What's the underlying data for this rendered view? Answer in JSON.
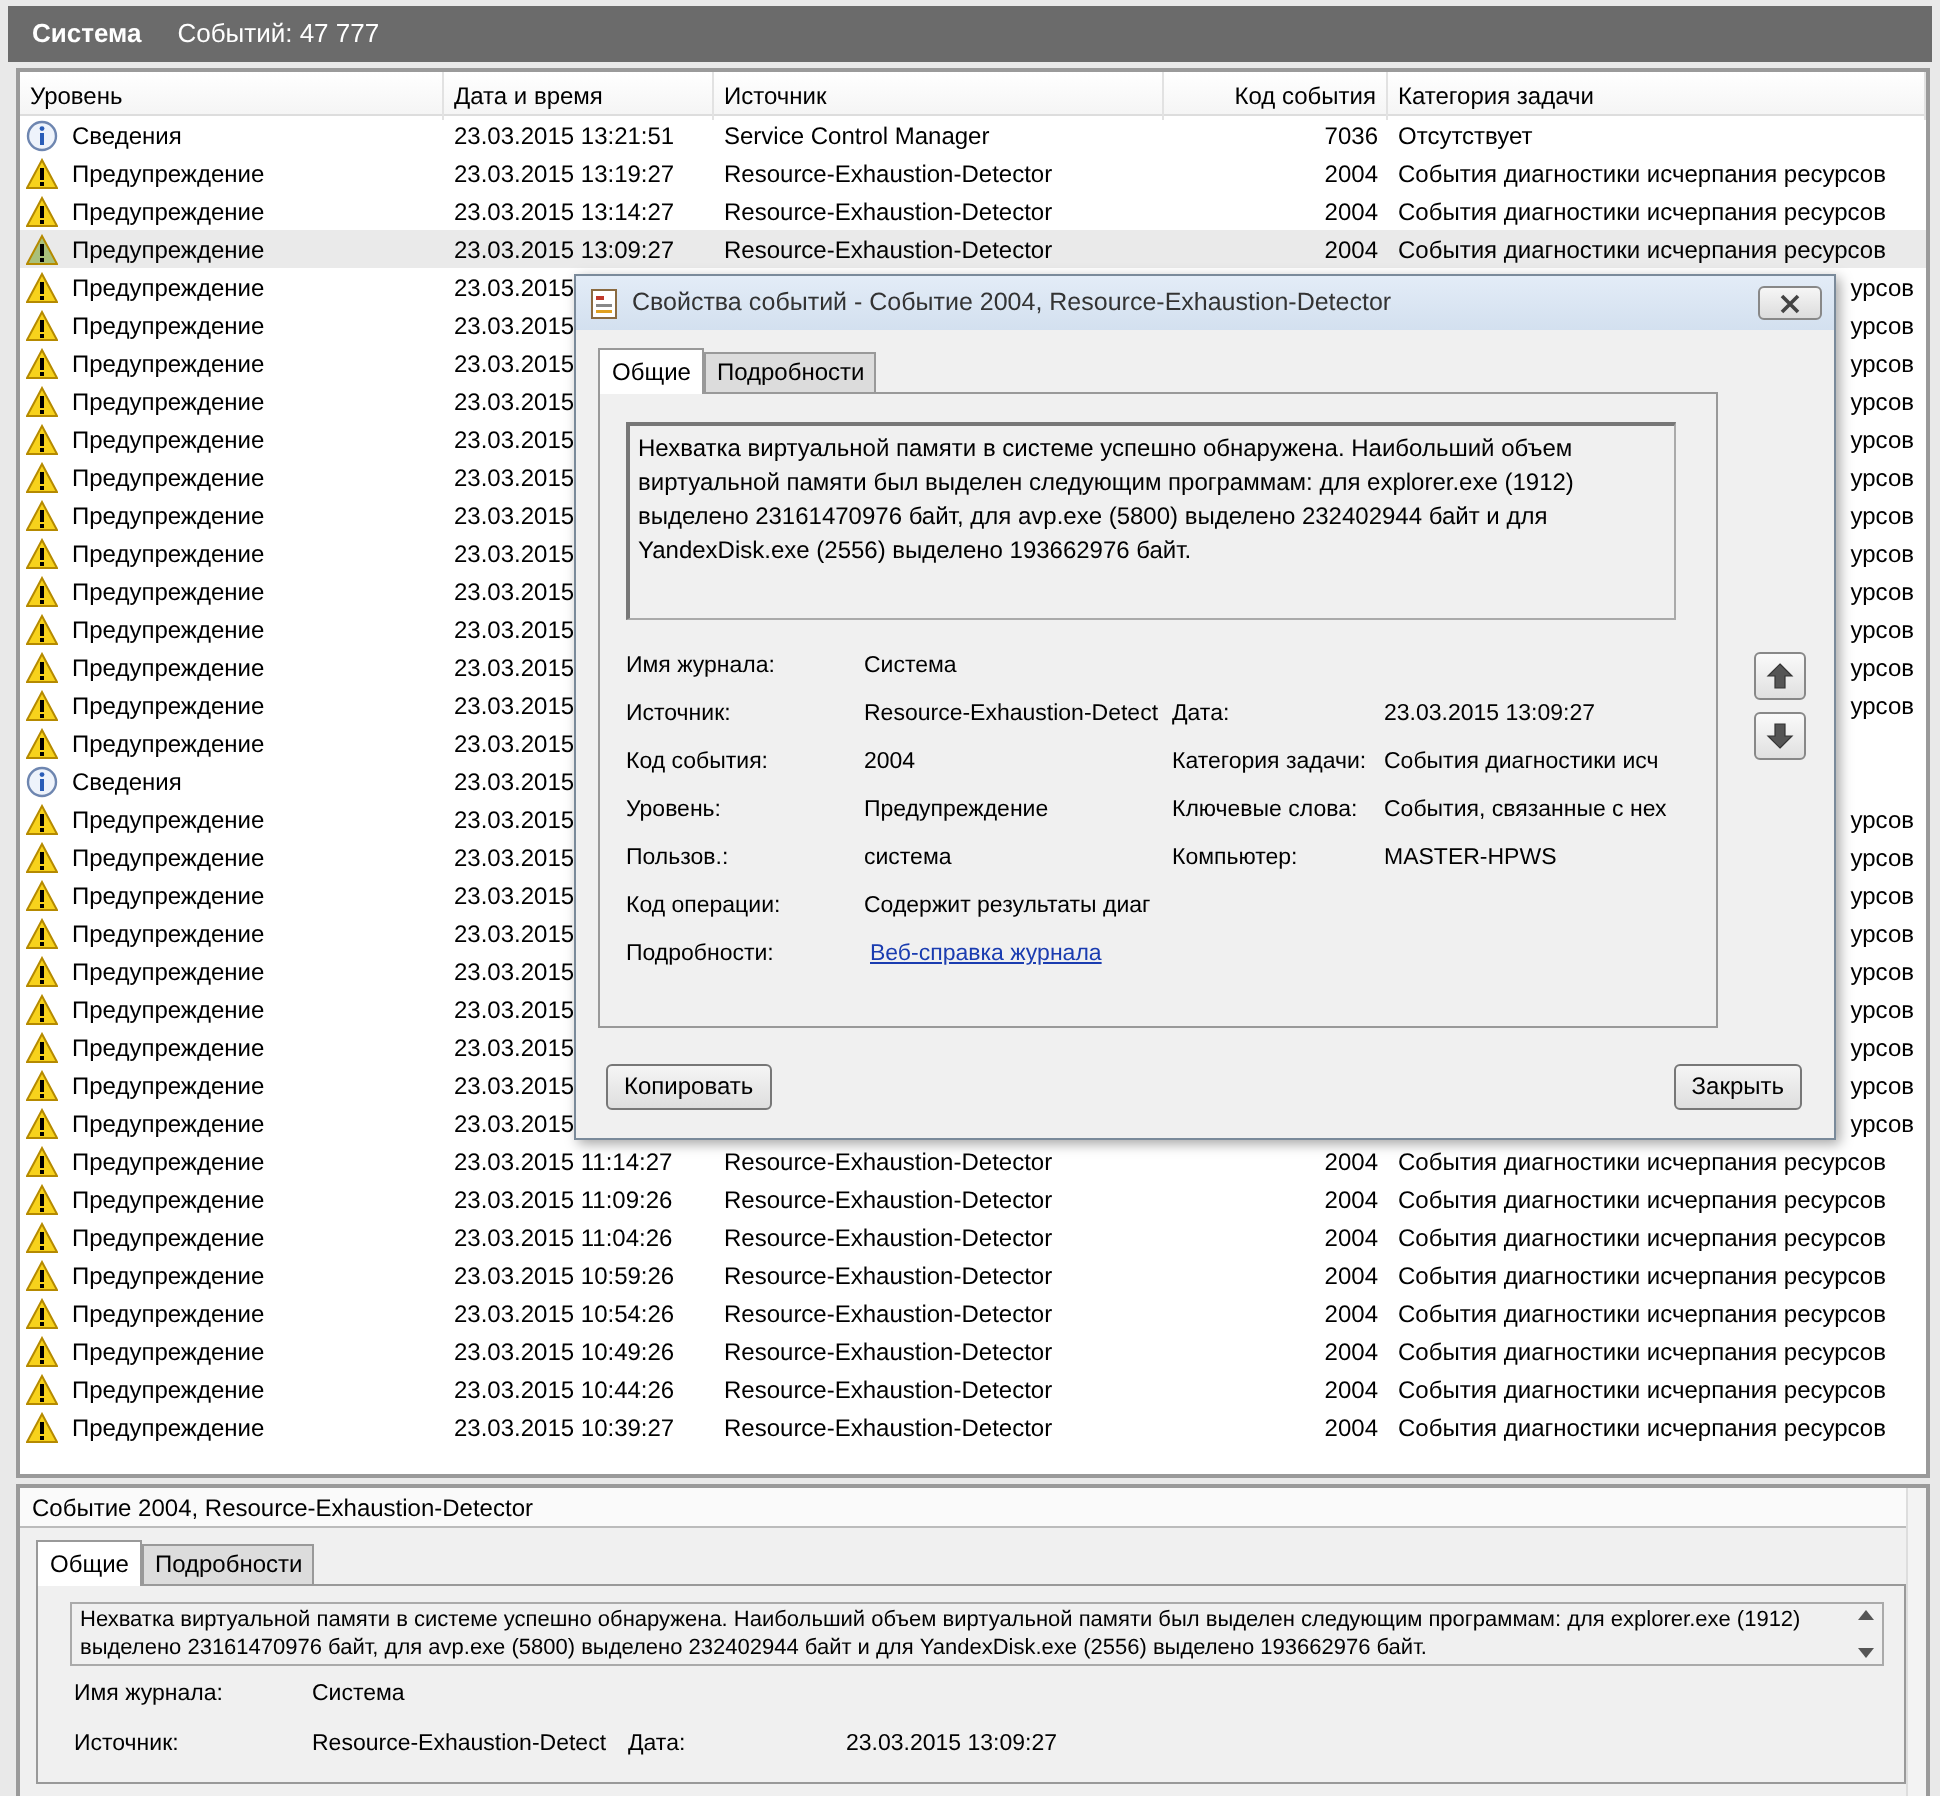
{
  "header": {
    "title": "Система",
    "count": "Событий: 47 777"
  },
  "table": {
    "columns": [
      "Уровень",
      "Дата и время",
      "Источник",
      "Код события",
      "Категория задачи"
    ],
    "rows": [
      {
        "kind": "info",
        "level": "Сведения",
        "date": "23.03.2015 13:21:51",
        "source": "Service Control Manager",
        "code": "7036",
        "category": "Отсутствует",
        "selected": false
      },
      {
        "kind": "warning",
        "level": "Предупреждение",
        "date": "23.03.2015 13:19:27",
        "source": "Resource-Exhaustion-Detector",
        "code": "2004",
        "category": "События диагностики исчерпания ресурсов",
        "selected": false
      },
      {
        "kind": "warning",
        "level": "Предупреждение",
        "date": "23.03.2015 13:14:27",
        "source": "Resource-Exhaustion-Detector",
        "code": "2004",
        "category": "События диагностики исчерпания ресурсов",
        "selected": false
      },
      {
        "kind": "warning",
        "level": "Предупреждение",
        "date": "23.03.2015 13:09:27",
        "source": "Resource-Exhaustion-Detector",
        "code": "2004",
        "category": "События диагностики исчерпания ресурсов",
        "selected": true
      },
      {
        "kind": "warning",
        "level": "Предупреждение",
        "date": "23.03.2015",
        "category": "урсов",
        "selected": false
      },
      {
        "kind": "warning",
        "level": "Предупреждение",
        "date": "23.03.2015",
        "category": "урсов",
        "selected": false
      },
      {
        "kind": "warning",
        "level": "Предупреждение",
        "date": "23.03.2015",
        "category": "урсов",
        "selected": false
      },
      {
        "kind": "warning",
        "level": "Предупреждение",
        "date": "23.03.2015",
        "category": "урсов",
        "selected": false
      },
      {
        "kind": "warning",
        "level": "Предупреждение",
        "date": "23.03.2015",
        "category": "урсов",
        "selected": false
      },
      {
        "kind": "warning",
        "level": "Предупреждение",
        "date": "23.03.2015",
        "category": "урсов",
        "selected": false
      },
      {
        "kind": "warning",
        "level": "Предупреждение",
        "date": "23.03.2015",
        "category": "урсов",
        "selected": false
      },
      {
        "kind": "warning",
        "level": "Предупреждение",
        "date": "23.03.2015",
        "category": "урсов",
        "selected": false
      },
      {
        "kind": "warning",
        "level": "Предупреждение",
        "date": "23.03.2015",
        "category": "урсов",
        "selected": false
      },
      {
        "kind": "warning",
        "level": "Предупреждение",
        "date": "23.03.2015",
        "category": "урсов",
        "selected": false
      },
      {
        "kind": "warning",
        "level": "Предупреждение",
        "date": "23.03.2015",
        "category": "урсов",
        "selected": false
      },
      {
        "kind": "warning",
        "level": "Предупреждение",
        "date": "23.03.2015",
        "category": "урсов",
        "selected": false
      },
      {
        "kind": "warning",
        "level": "Предупреждение",
        "date": "23.03.2015",
        "selected": false
      },
      {
        "kind": "info",
        "level": "Сведения",
        "date": "23.03.2015",
        "selected": false
      },
      {
        "kind": "warning",
        "level": "Предупреждение",
        "date": "23.03.2015",
        "category": "урсов",
        "selected": false
      },
      {
        "kind": "warning",
        "level": "Предупреждение",
        "date": "23.03.2015",
        "category": "урсов",
        "selected": false
      },
      {
        "kind": "warning",
        "level": "Предупреждение",
        "date": "23.03.2015",
        "category": "урсов",
        "selected": false
      },
      {
        "kind": "warning",
        "level": "Предупреждение",
        "date": "23.03.2015",
        "category": "урсов",
        "selected": false
      },
      {
        "kind": "warning",
        "level": "Предупреждение",
        "date": "23.03.2015",
        "category": "урсов",
        "selected": false
      },
      {
        "kind": "warning",
        "level": "Предупреждение",
        "date": "23.03.2015",
        "category": "урсов",
        "selected": false
      },
      {
        "kind": "warning",
        "level": "Предупреждение",
        "date": "23.03.2015",
        "category": "урсов",
        "selected": false
      },
      {
        "kind": "warning",
        "level": "Предупреждение",
        "date": "23.03.2015",
        "category": "урсов",
        "selected": false
      },
      {
        "kind": "warning",
        "level": "Предупреждение",
        "date": "23.03.2015",
        "category": "урсов",
        "selected": false
      },
      {
        "kind": "warning",
        "level": "Предупреждение",
        "date": "23.03.2015 11:14:27",
        "source": "Resource-Exhaustion-Detector",
        "code": "2004",
        "category": "События диагностики исчерпания ресурсов",
        "selected": false
      },
      {
        "kind": "warning",
        "level": "Предупреждение",
        "date": "23.03.2015 11:09:26",
        "source": "Resource-Exhaustion-Detector",
        "code": "2004",
        "category": "События диагностики исчерпания ресурсов",
        "selected": false
      },
      {
        "kind": "warning",
        "level": "Предупреждение",
        "date": "23.03.2015 11:04:26",
        "source": "Resource-Exhaustion-Detector",
        "code": "2004",
        "category": "События диагностики исчерпания ресурсов",
        "selected": false
      },
      {
        "kind": "warning",
        "level": "Предупреждение",
        "date": "23.03.2015 10:59:26",
        "source": "Resource-Exhaustion-Detector",
        "code": "2004",
        "category": "События диагностики исчерпания ресурсов",
        "selected": false
      },
      {
        "kind": "warning",
        "level": "Предупреждение",
        "date": "23.03.2015 10:54:26",
        "source": "Resource-Exhaustion-Detector",
        "code": "2004",
        "category": "События диагностики исчерпания ресурсов",
        "selected": false
      },
      {
        "kind": "warning",
        "level": "Предупреждение",
        "date": "23.03.2015 10:49:26",
        "source": "Resource-Exhaustion-Detector",
        "code": "2004",
        "category": "События диагностики исчерпания ресурсов",
        "selected": false
      },
      {
        "kind": "warning",
        "level": "Предупреждение",
        "date": "23.03.2015 10:44:26",
        "source": "Resource-Exhaustion-Detector",
        "code": "2004",
        "category": "События диагностики исчерпания ресурсов",
        "selected": false
      },
      {
        "kind": "warning",
        "level": "Предупреждение",
        "date": "23.03.2015 10:39:27",
        "source": "Resource-Exhaustion-Detector",
        "code": "2004",
        "category": "События диагностики исчерпания ресурсов",
        "selected": false
      }
    ]
  },
  "dialog": {
    "title": "Свойства событий - Событие 2004, Resource-Exhaustion-Detector",
    "tabs": [
      {
        "label": "Общие",
        "selected": true
      },
      {
        "label": "Подробности",
        "selected": false
      }
    ],
    "description": "Нехватка виртуальной памяти в системе успешно обнаружена. Наибольший объем виртуальной памяти был выделен следующим программам: для explorer.exe (1912) выделено 23161470976 байт, для avp.exe (5800) выделено 232402944 байт и для YandexDisk.exe (2556) выделено 193662976 байт.",
    "fields": [
      {
        "label": "Имя журнала:",
        "value": "Система"
      },
      {
        "label": "Источник:",
        "value": "Resource-Exhaustion-Detect",
        "label2": "Дата:",
        "value2": "23.03.2015 13:09:27"
      },
      {
        "label": "Код события:",
        "value": "2004",
        "label2": "Категория задачи:",
        "value2": "События диагностики исч"
      },
      {
        "label": "Уровень:",
        "value": "Предупреждение",
        "label2": "Ключевые слова:",
        "value2": "События, связанные с нех"
      },
      {
        "label": "Пользов.:",
        "value": "система",
        "label2": "Компьютер:",
        "value2": "MASTER-HPWS"
      },
      {
        "label": "Код операции:",
        "value": "Содержит результаты диаг"
      },
      {
        "label": "Подробности:",
        "value": "Веб-справка журнала",
        "kind": "link"
      }
    ],
    "buttons": [
      "Копировать",
      "Закрыть"
    ]
  },
  "preview": {
    "title": "Событие 2004, Resource-Exhaustion-Detector",
    "tabs": [
      {
        "label": "Общие",
        "selected": true
      },
      {
        "label": "Подробности",
        "selected": false
      }
    ],
    "description": "Нехватка виртуальной памяти в системе успешно обнаружена. Наибольший объем виртуальной памяти был выделен следующим программам: для explorer.exe (1912) выделено 23161470976 байт, для avp.exe (5800) выделено 232402944 байт и для YandexDisk.exe (2556) выделено 193662976 байт.",
    "fields": [
      {
        "label": "Имя журнала:",
        "value": "Система"
      },
      {
        "label": "Источник:",
        "value": "Resource-Exhaustion-Detect",
        "label2": "Дата:",
        "value2": "23.03.2015 13:09:27"
      }
    ]
  }
}
